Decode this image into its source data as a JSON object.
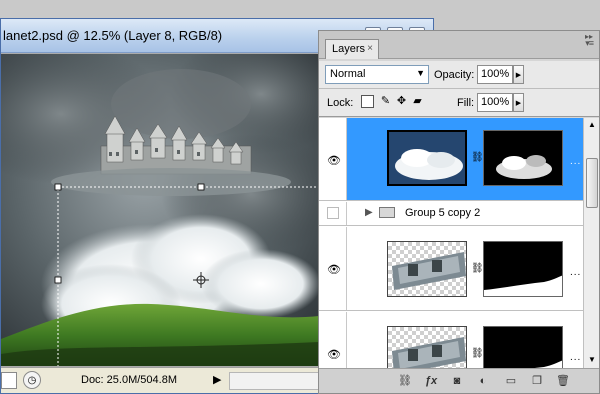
{
  "document": {
    "title": "lanet2.psd @ 12.5% (Layer 8, RGB/8)",
    "status_doc": "Doc: 25.0M/504.8M"
  },
  "layers_panel": {
    "tab_label": "Layers",
    "tab_close": "×",
    "blend_mode": "Normal",
    "opacity_label": "Opacity:",
    "opacity_value": "100%",
    "lock_label": "Lock:",
    "fill_label": "Fill:",
    "fill_value": "100%",
    "layers": [
      {
        "name": "",
        "selected": true,
        "visible": true,
        "type": "layer-with-mask"
      },
      {
        "name": "Group 5 copy 2",
        "selected": false,
        "visible": false,
        "type": "group"
      },
      {
        "name": "",
        "selected": false,
        "visible": true,
        "type": "layer-with-mask"
      },
      {
        "name": "",
        "selected": false,
        "visible": true,
        "type": "layer-with-mask"
      }
    ]
  },
  "colors": {
    "selection": "#3399ff",
    "panel_bg": "#d6d6d6",
    "titlebar": "#b9d0ec"
  },
  "icons": {
    "eye": "eye-icon",
    "chain": "link-icon",
    "folder": "folder-icon",
    "crosshair": "crosshair-icon"
  }
}
